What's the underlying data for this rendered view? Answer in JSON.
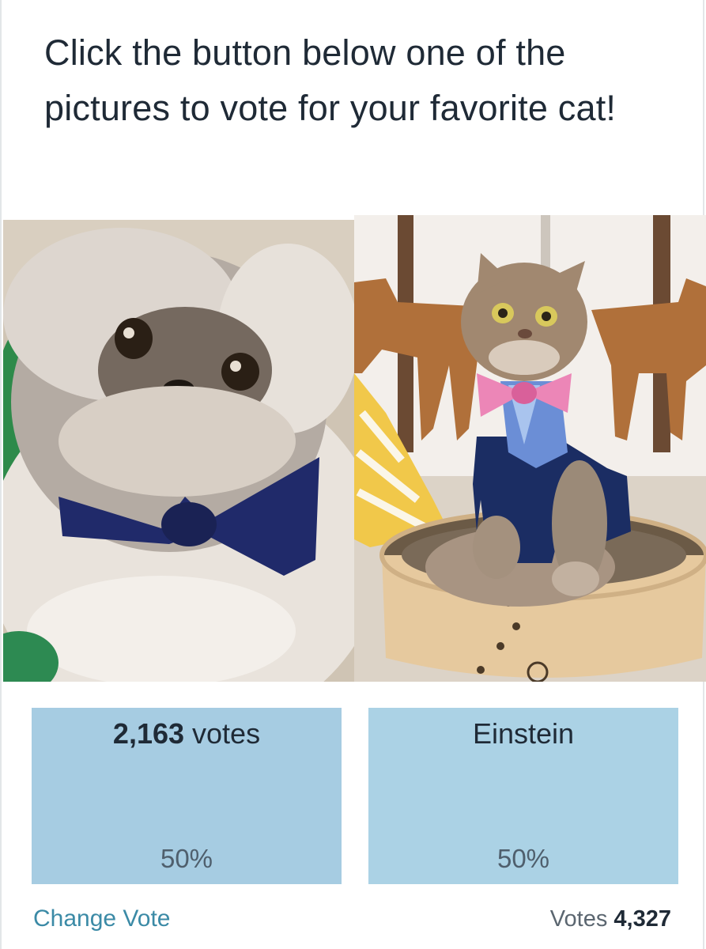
{
  "poll": {
    "question": "Click the button below one of the pictures to vote for your favorite cat!",
    "options": [
      {
        "votes_count": "2,163",
        "votes_word": "votes",
        "percent": "50%",
        "share": 0.5
      },
      {
        "label": "Einstein",
        "percent": "50%",
        "share": 0.5
      }
    ],
    "change_vote_label": "Change Vote",
    "total_label": "Votes",
    "total_count": "4,327"
  },
  "colors": {
    "option_fill": "#abd2e5",
    "link": "#3b8aa6",
    "text": "#1f2a36"
  },
  "images": [
    {
      "subject": "fluffy grey-white Himalayan cat with a navy bow tie",
      "icon": "cat-photo"
    },
    {
      "subject": "tabby Exotic Shorthair cat in a navy cardigan, pink bow tie and plaid shirt sitting in a round scratcher bed, deer wall art behind",
      "icon": "cat-photo"
    }
  ]
}
